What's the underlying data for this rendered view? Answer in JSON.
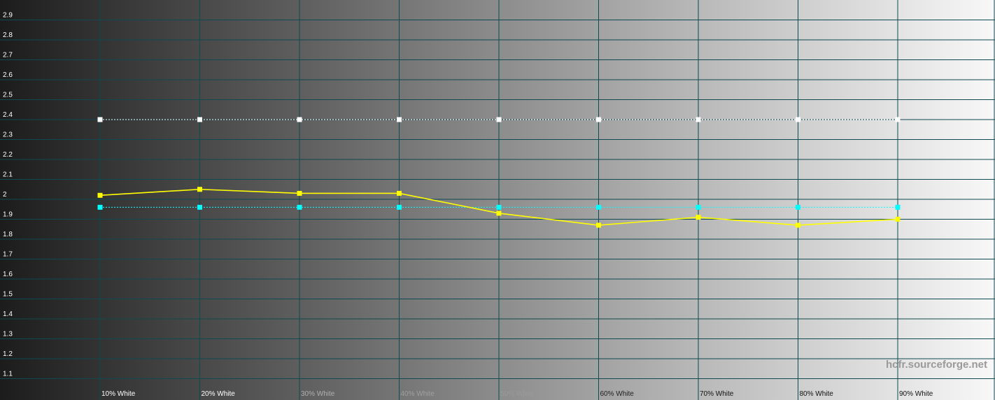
{
  "chart_data": {
    "type": "line",
    "title": "",
    "xlabel": "",
    "ylabel": "",
    "categories": [
      "10% White",
      "20% White",
      "30% White",
      "40% White",
      "50% White",
      "60% White",
      "70% White",
      "80% White",
      "90% White"
    ],
    "ylim": [
      1.0,
      3.0
    ],
    "yticks": [
      1.1,
      1.2,
      1.3,
      1.4,
      1.5,
      1.6,
      1.7,
      1.8,
      1.9,
      2,
      2.1,
      2.2,
      2.3,
      2.4,
      2.5,
      2.6,
      2.7,
      2.8,
      2.9
    ],
    "ytick_labels": [
      "1.1",
      "1.2",
      "1.3",
      "1.4",
      "1.5",
      "1.6",
      "1.7",
      "1.8",
      "1.9",
      "2",
      "2.1",
      "2.2",
      "2.3",
      "2.4",
      "2.5",
      "2.6",
      "2.7",
      "2.8",
      "2.9"
    ],
    "grid": true,
    "background": "grayscale ramp from black to white",
    "series": [
      {
        "values": [
          2.4,
          2.4,
          2.4,
          2.4,
          2.4,
          2.4,
          2.4,
          2.4,
          2.4
        ],
        "color": "#ffffff",
        "style": "dotted"
      },
      {
        "values": [
          1.96,
          1.96,
          1.96,
          1.96,
          1.96,
          1.96,
          1.96,
          1.96,
          1.96
        ],
        "color": "#00ffff",
        "style": "dotted"
      },
      {
        "values": [
          2.02,
          2.05,
          2.03,
          2.03,
          1.93,
          1.87,
          1.91,
          1.87,
          1.9
        ],
        "color": "#ffff00",
        "style": "solid"
      }
    ],
    "watermark": "hcfr.sourceforge.net"
  }
}
